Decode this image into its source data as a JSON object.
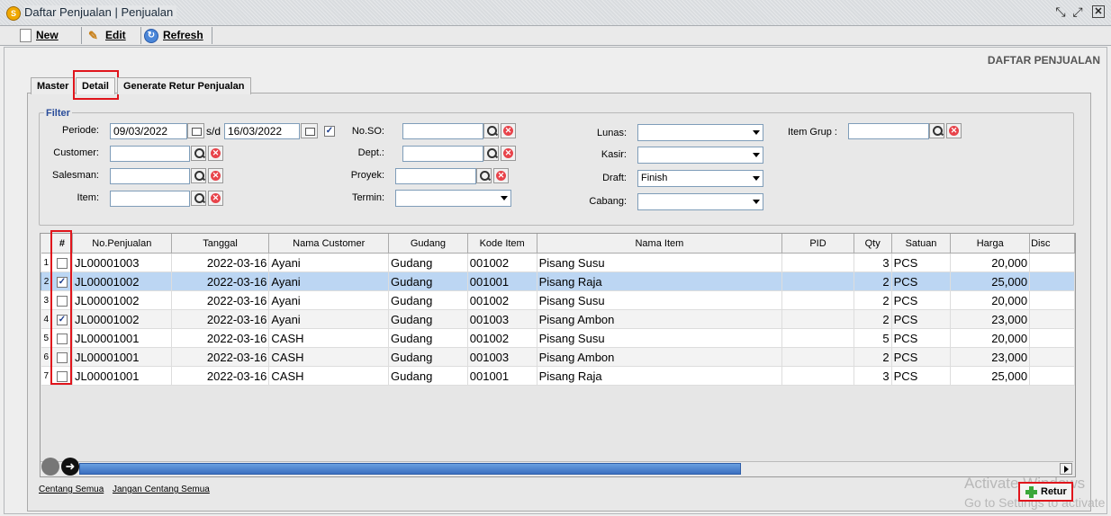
{
  "window": {
    "title": "Daftar Penjualan | Penjualan",
    "icon": "app-logo-icon"
  },
  "toolbar": {
    "new_label": "New",
    "edit_label": "Edit",
    "refresh_label": "Refresh"
  },
  "page_heading": "DAFTAR PENJUALAN",
  "tabs": [
    {
      "label": "Master",
      "active": false
    },
    {
      "label": "Detail",
      "active": true
    },
    {
      "label": "Generate Retur Penjualan",
      "active": false
    }
  ],
  "filter": {
    "legend": "Filter",
    "periode_label": "Periode:",
    "periode_from": "09/03/2022",
    "sd_label": "s/d",
    "periode_to": "16/03/2022",
    "periode_checked": true,
    "customer_label": "Customer:",
    "salesman_label": "Salesman:",
    "item_label": "Item:",
    "noso_label": "No.SO:",
    "dept_label": "Dept.:",
    "proyek_label": "Proyek:",
    "termin_label": "Termin:",
    "lunas_label": "Lunas:",
    "kasir_label": "Kasir:",
    "draft_label": "Draft:",
    "draft_value": "Finish",
    "cabang_label": "Cabang:",
    "itemgrup_label": "Item Grup :"
  },
  "grid": {
    "columns": [
      "#",
      "No.Penjualan",
      "Tanggal",
      "Nama Customer",
      "Gudang",
      "Kode Item",
      "Nama Item",
      "PID",
      "Qty",
      "Satuan",
      "Harga",
      "Disc"
    ],
    "rows": [
      {
        "n": "1",
        "checked": false,
        "no": "JL00001003",
        "tanggal": "2022-03-16",
        "customer": "Ayani",
        "gudang": "Gudang",
        "kode": "001002",
        "item": "Pisang Susu",
        "pid": "",
        "qty": "3",
        "satuan": "PCS",
        "harga": "20,000"
      },
      {
        "n": "2",
        "checked": true,
        "no": "JL00001002",
        "tanggal": "2022-03-16",
        "customer": "Ayani",
        "gudang": "Gudang",
        "kode": "001001",
        "item": "Pisang Raja",
        "pid": "",
        "qty": "2",
        "satuan": "PCS",
        "harga": "25,000"
      },
      {
        "n": "3",
        "checked": false,
        "no": "JL00001002",
        "tanggal": "2022-03-16",
        "customer": "Ayani",
        "gudang": "Gudang",
        "kode": "001002",
        "item": "Pisang Susu",
        "pid": "",
        "qty": "2",
        "satuan": "PCS",
        "harga": "20,000"
      },
      {
        "n": "4",
        "checked": true,
        "no": "JL00001002",
        "tanggal": "2022-03-16",
        "customer": "Ayani",
        "gudang": "Gudang",
        "kode": "001003",
        "item": "Pisang Ambon",
        "pid": "",
        "qty": "2",
        "satuan": "PCS",
        "harga": "23,000"
      },
      {
        "n": "5",
        "checked": false,
        "no": "JL00001001",
        "tanggal": "2022-03-16",
        "customer": "CASH",
        "gudang": "Gudang",
        "kode": "001002",
        "item": "Pisang Susu",
        "pid": "",
        "qty": "5",
        "satuan": "PCS",
        "harga": "20,000"
      },
      {
        "n": "6",
        "checked": false,
        "no": "JL00001001",
        "tanggal": "2022-03-16",
        "customer": "CASH",
        "gudang": "Gudang",
        "kode": "001003",
        "item": "Pisang Ambon",
        "pid": "",
        "qty": "2",
        "satuan": "PCS",
        "harga": "23,000"
      },
      {
        "n": "7",
        "checked": false,
        "no": "JL00001001",
        "tanggal": "2022-03-16",
        "customer": "CASH",
        "gudang": "Gudang",
        "kode": "001001",
        "item": "Pisang Raja",
        "pid": "",
        "qty": "3",
        "satuan": "PCS",
        "harga": "25,000"
      }
    ],
    "selected_row": 2
  },
  "footer": {
    "check_all_label": "Centang Semua",
    "uncheck_all_label": "Jangan Centang Semua",
    "retur_label": "Retur"
  },
  "watermark": {
    "line1": "Activate Windows",
    "line2": "Go to Settings to activate"
  },
  "colors": {
    "highlight": "#e0151c",
    "selected_row": "#bcd6f3",
    "scroll_thumb": "#3b6fc0"
  }
}
